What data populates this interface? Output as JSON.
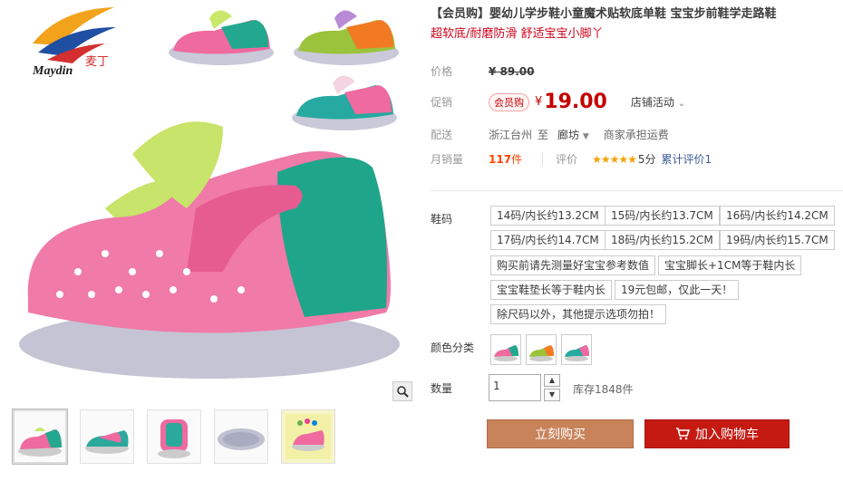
{
  "product": {
    "title": "【会员购】婴幼儿学步鞋小童魔术贴软底单鞋 宝宝步前鞋学走路鞋",
    "subtitle": "超软底/耐磨防滑 舒适宝宝小脚丫",
    "brand": "Maydin",
    "brand_cn": "麦丁"
  },
  "price": {
    "label": "价格",
    "currency": "¥",
    "original": "89.00"
  },
  "promo": {
    "label": "促销",
    "badge": "会员购",
    "currency": "¥",
    "value": "19.00",
    "store_promo": "店铺活动"
  },
  "shipping": {
    "label": "配送",
    "from": "浙江台州",
    "to_word": "至",
    "to": "廊坊",
    "note": "商家承担运费"
  },
  "sales": {
    "label": "月销量",
    "count": "117",
    "unit": "件",
    "review_label": "评价",
    "stars": "★★★★★",
    "score": "5分",
    "review_link": "累计评价1"
  },
  "sizes": {
    "label": "鞋码",
    "options": [
      "14码/内长约13.2CM",
      "15码/内长约13.7CM",
      "16码/内长约14.2CM",
      "17码/内长约14.7CM",
      "18码/内长约15.2CM",
      "19码/内长约15.7CM",
      "购买前请先测量好宝宝参考数值",
      "宝宝脚长+1CM等于鞋内长",
      "宝宝鞋垫长等于鞋内长",
      "19元包邮，仅此一天！",
      "除尺码以外，其他提示选项勿拍！"
    ]
  },
  "color": {
    "label": "颜色分类"
  },
  "quantity": {
    "label": "数量",
    "value": "1",
    "stock": "库存1848件"
  },
  "actions": {
    "buy": "立刻购买",
    "cart": "加入购物车"
  },
  "colors": {
    "accent": "#c40000",
    "buy_btn": "#c8835a",
    "cart_btn": "#c41a12"
  }
}
